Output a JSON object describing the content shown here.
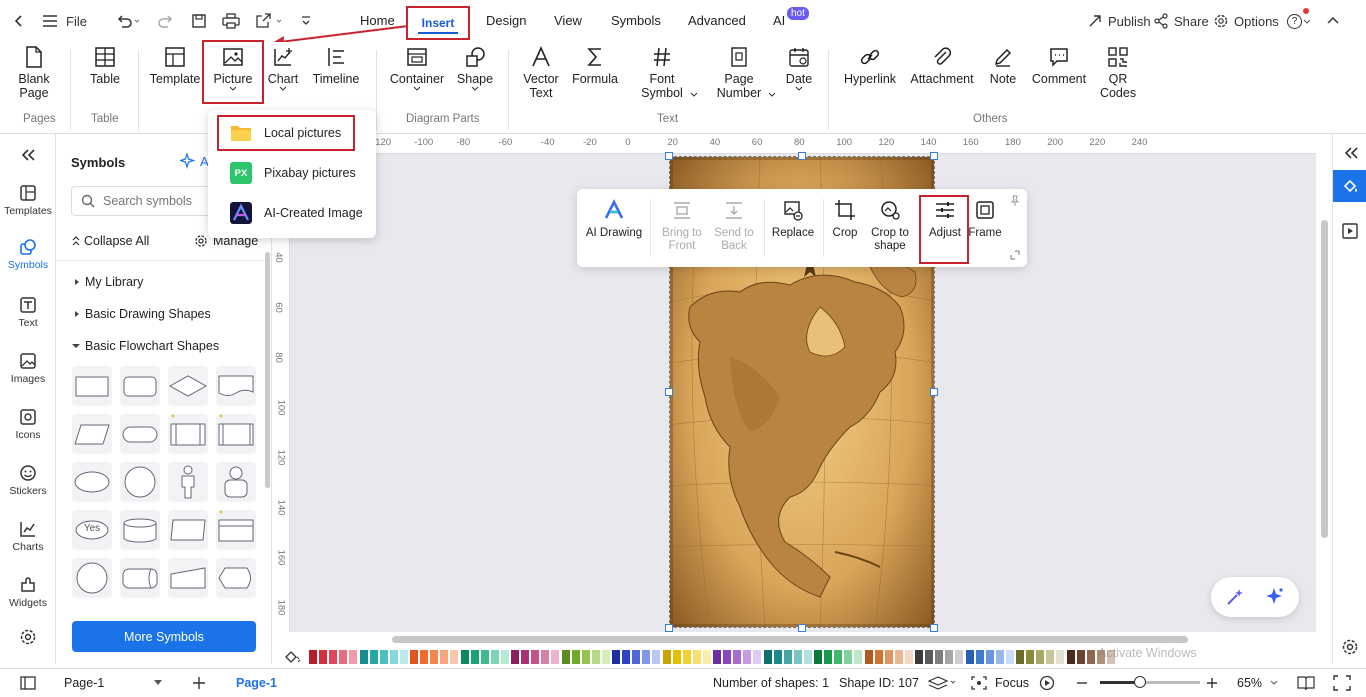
{
  "topbar": {
    "file_label": "File",
    "tabs": [
      "Home",
      "Insert",
      "Design",
      "View",
      "Symbols",
      "Advanced",
      "AI"
    ],
    "hot_badge": "hot",
    "publish_label": "Publish",
    "share_label": "Share",
    "options_label": "Options",
    "help_label": "?"
  },
  "ribbon": {
    "blank_page": [
      "Blank",
      "Page"
    ],
    "table": "Table",
    "template": "Template",
    "picture": "Picture",
    "chart": "Chart",
    "timeline": "Timeline",
    "container": "Container",
    "shape": "Shape",
    "vector_text": [
      "Vector",
      "Text"
    ],
    "formula": "Formula",
    "font_symbol": [
      "Font",
      "Symbol"
    ],
    "page_number": [
      "Page",
      "Number"
    ],
    "date": "Date",
    "hyperlink": "Hyperlink",
    "attachment": "Attachment",
    "note": "Note",
    "comment": "Comment",
    "qr_codes": [
      "QR",
      "Codes"
    ],
    "groups": [
      "Pages",
      "Table",
      "Diagram Parts",
      "Text",
      "Others"
    ]
  },
  "picture_menu": {
    "items": [
      "Local pictures",
      "Pixabay pictures",
      "AI-Created Image"
    ],
    "pixabay_icon_text": "PX"
  },
  "rail": [
    "Templates",
    "Symbols",
    "Text",
    "Images",
    "Icons",
    "Stickers",
    "Charts",
    "Widgets"
  ],
  "symbols_panel": {
    "title": "Symbols",
    "ai_label": "A",
    "search_placeholder": "Search symbols",
    "collapse_all": "Collapse All",
    "manage": "Manage",
    "sections": [
      "My Library",
      "Basic Drawing Shapes",
      "Basic Flowchart Shapes"
    ],
    "yes_shape_text": "Yes",
    "more_symbols": "More Symbols"
  },
  "ruler": {
    "horizontal": [
      "-120",
      "-100",
      "-80",
      "-60",
      "-40",
      "-20",
      "0",
      "20",
      "40",
      "60",
      "80",
      "100",
      "120",
      "140",
      "160",
      "180",
      "200",
      "220",
      "240"
    ],
    "vertical": [
      "40",
      "60",
      "80",
      "100",
      "120",
      "140",
      "160",
      "180"
    ]
  },
  "float_toolbar": {
    "ai_drawing": "AI Drawing",
    "bring_to_front": [
      "Bring to",
      "Front"
    ],
    "send_to_back": [
      "Send to",
      "Back"
    ],
    "replace": "Replace",
    "crop": "Crop",
    "crop_to_shape": [
      "Crop to",
      "shape"
    ],
    "adjust": "Adjust",
    "frame": "Frame"
  },
  "watermark": "Activate Windows",
  "status": {
    "page_select": "Page-1",
    "active_page": "Page-1",
    "shape_count": "Number of shapes: 1",
    "shape_id": "Shape ID: 107",
    "focus": "Focus",
    "zoom": "65%",
    "zoom_fraction": 0.4
  },
  "colors": {
    "accent": "#1a73e8",
    "highlight_box": "#c8242f",
    "swatches": [
      "#b71c2c",
      "#d32f3f",
      "#e0455a",
      "#e96b80",
      "#f19aa9",
      "#178f8f",
      "#27a6a6",
      "#4bc0c0",
      "#86d8d8",
      "#b8ecec",
      "#e0561f",
      "#f26b2e",
      "#f4854f",
      "#f7a57c",
      "#fac6ab",
      "#0a8a5a",
      "#1aa374",
      "#3dbd8f",
      "#7ad6b2",
      "#b4ecd3",
      "#8e1f5e",
      "#a8326f",
      "#c45188",
      "#d980a8",
      "#ecb3ca",
      "#5a8c1f",
      "#72a82c",
      "#93c24f",
      "#b5d985",
      "#d6ecb8",
      "#1a2fa3",
      "#2a44c4",
      "#4f68d8",
      "#8496e6",
      "#bcc6f2",
      "#c9a400",
      "#e6be00",
      "#f2d233",
      "#f7e070",
      "#fbeeab",
      "#6f2ea3",
      "#8a45c2",
      "#a76dd6",
      "#c59be6",
      "#e0c9f2",
      "#0f6e6e",
      "#1d8a8a",
      "#45a6a6",
      "#7cc4c4",
      "#b5e0e0",
      "#0a7a3a",
      "#189a4c",
      "#42b46b",
      "#82d09c",
      "#bce8c9",
      "#b35a1f",
      "#cf7433",
      "#e0955e",
      "#eab793",
      "#f4d8c4",
      "#3a3a3a",
      "#5a5a5a",
      "#7e7e7e",
      "#a6a6a6",
      "#cfcfcf",
      "#2a5fb0",
      "#3f7ad0",
      "#6896df",
      "#9bb8ea",
      "#cddcf5",
      "#6b6b2a",
      "#8a8a3d",
      "#a8a866",
      "#c6c699",
      "#e2e2cc",
      "#4a2a1a",
      "#6b4230",
      "#8e6651",
      "#b38f7e",
      "#d6c1b6"
    ]
  }
}
